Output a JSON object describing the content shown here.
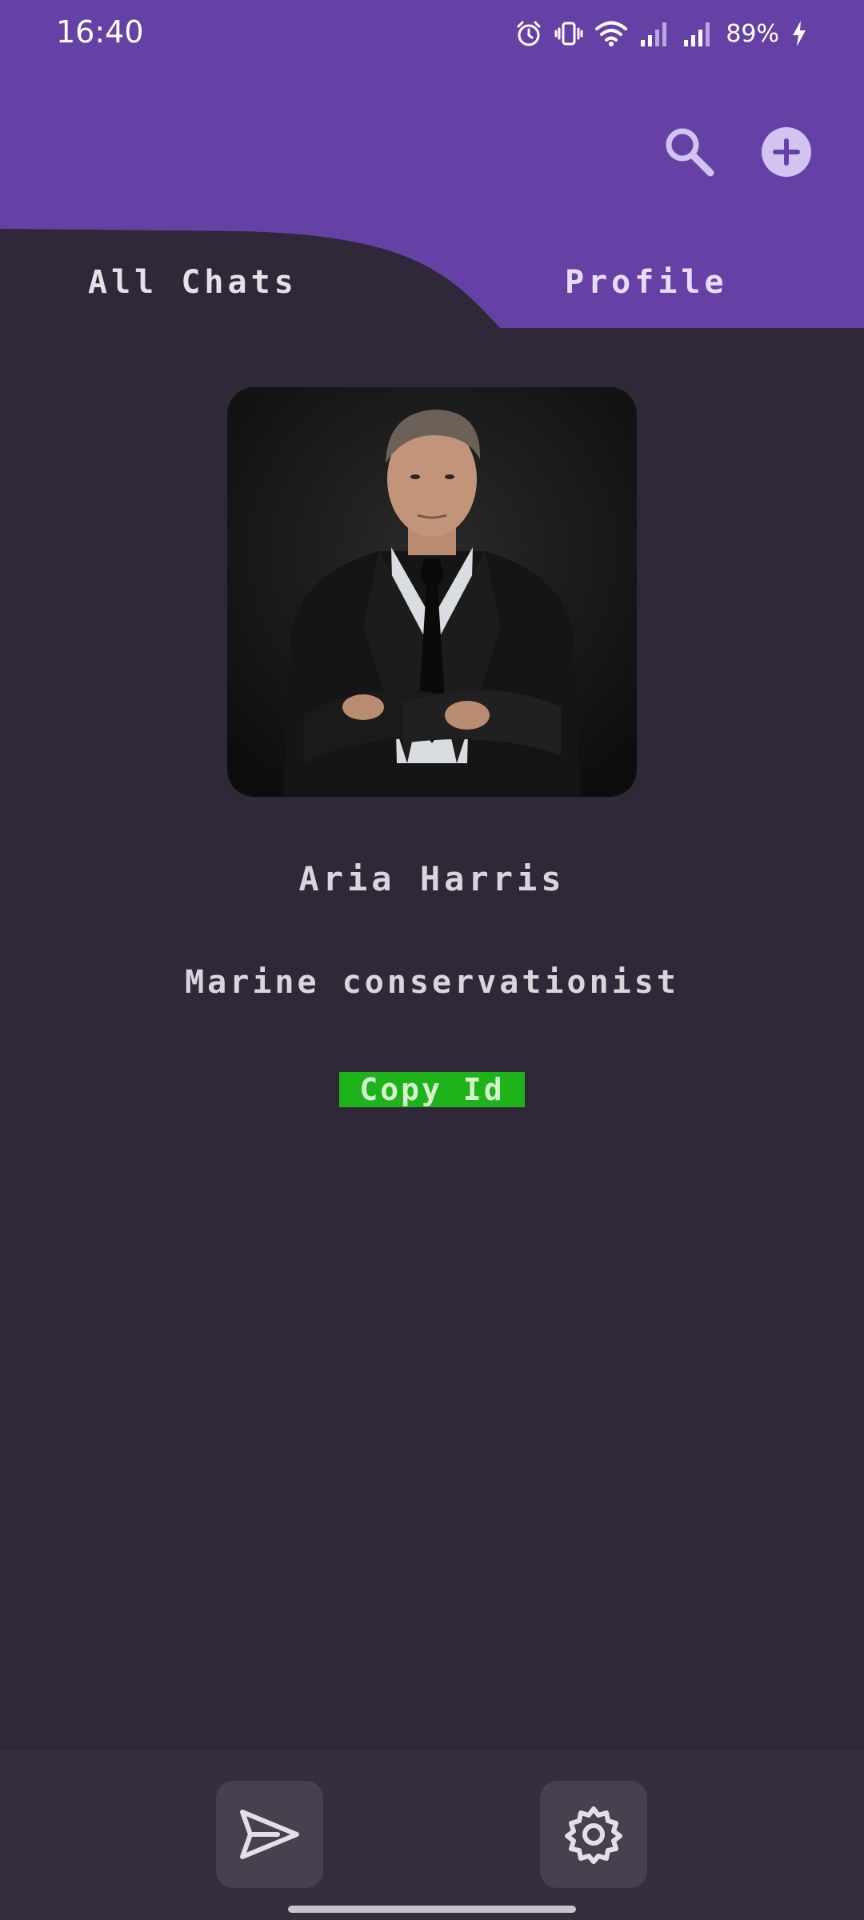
{
  "status_bar": {
    "time": "16:40",
    "battery": "89%",
    "icons": [
      "alarm-icon",
      "vibrate-icon",
      "wifi-icon",
      "signal-icon",
      "signal-icon",
      "charging-icon"
    ]
  },
  "header": {
    "icons": [
      "search-icon",
      "add-icon"
    ]
  },
  "tabs": [
    {
      "label": "All Chats",
      "selected": false
    },
    {
      "label": "Profile",
      "selected": true
    }
  ],
  "profile": {
    "avatar_alt": "profile photo",
    "name": "Aria Harris",
    "bio": "Marine conservationist",
    "copy_id_label": "Copy Id"
  },
  "bottom_nav": {
    "icons": [
      "send-icon",
      "settings-icon"
    ]
  },
  "colors": {
    "header_purple": "#6641a5",
    "background": "#2e2838",
    "copy_button_green": "#1fb31b",
    "nav_bar": "#342e3e"
  }
}
